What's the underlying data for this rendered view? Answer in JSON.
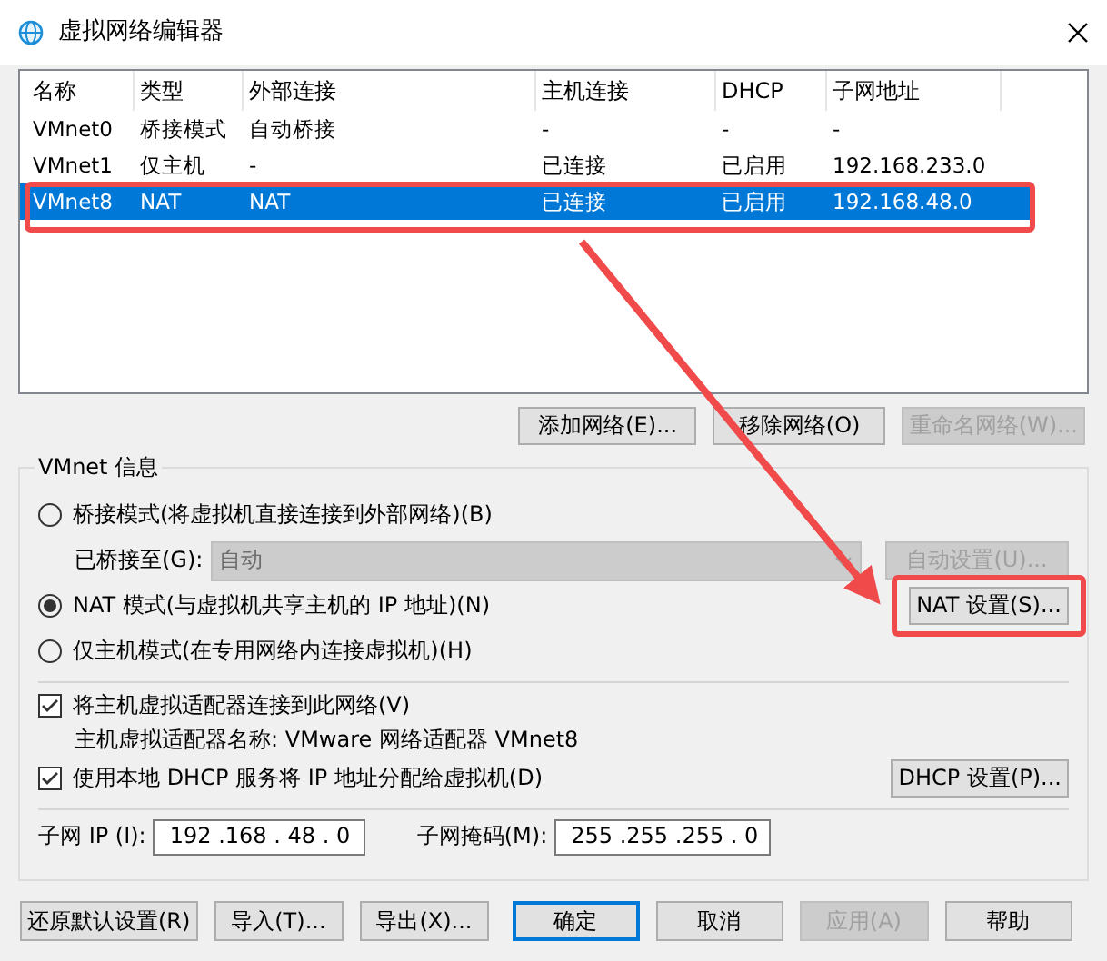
{
  "window": {
    "title": "虚拟网络编辑器"
  },
  "network_table": {
    "columns": [
      "名称",
      "类型",
      "外部连接",
      "主机连接",
      "DHCP",
      "子网地址"
    ],
    "rows": [
      {
        "cells": [
          "VMnet0",
          "桥接模式",
          "自动桥接",
          "-",
          "-",
          "-"
        ],
        "selected": false
      },
      {
        "cells": [
          "VMnet1",
          "仅主机",
          "-",
          "已连接",
          "已启用",
          "192.168.233.0"
        ],
        "selected": false
      },
      {
        "cells": [
          "VMnet8",
          "NAT",
          "NAT",
          "已连接",
          "已启用",
          "192.168.48.0"
        ],
        "selected": true
      }
    ]
  },
  "table_buttons": [
    {
      "label": "添加网络(E)...",
      "disabled": false
    },
    {
      "label": "移除网络(O)",
      "disabled": false
    },
    {
      "label": "重命名网络(W)...",
      "disabled": true
    }
  ],
  "vmnet_info": {
    "title": "VMnet 信息",
    "bridged_mode": {
      "label": "桥接模式(将虚拟机直接连接到外部网络)(B)",
      "selected": false
    },
    "bridged_to": {
      "label": "已桥接至(G):",
      "value": "自动",
      "disabled": true
    },
    "auto_settings_button": {
      "label": "自动设置(U)...",
      "disabled": true
    },
    "nat_mode": {
      "label": "NAT 模式(与虚拟机共享主机的 IP 地址)(N)",
      "selected": true
    },
    "nat_settings_button": {
      "label": "NAT 设置(S)...",
      "disabled": false
    },
    "host_only_mode": {
      "label": "仅主机模式(在专用网络内连接虚拟机)(H)",
      "selected": false
    },
    "connect_adapter": {
      "label": "将主机虚拟适配器连接到此网络(V)",
      "checked": true
    },
    "adapter_name": "主机虚拟适配器名称: VMware 网络适配器 VMnet8",
    "use_dhcp": {
      "label": "使用本地 DHCP 服务将 IP 地址分配给虚拟机(D)",
      "checked": true
    },
    "dhcp_settings_button": {
      "label": "DHCP 设置(P)...",
      "disabled": false
    },
    "subnet_ip": {
      "label": "子网 IP (I):",
      "value": "192 .168 . 48 . 0"
    },
    "subnet_mask": {
      "label": "子网掩码(M):",
      "value": "255 .255 .255 . 0"
    }
  },
  "footer_buttons": [
    {
      "label": "还原默认设置(R)",
      "disabled": false,
      "default": false
    },
    {
      "label": "导入(T)...",
      "disabled": false,
      "default": false
    },
    {
      "label": "导出(X)...",
      "disabled": false,
      "default": false
    },
    {
      "label": "确定",
      "disabled": false,
      "default": true
    },
    {
      "label": "取消",
      "disabled": false,
      "default": false
    },
    {
      "label": "应用(A)",
      "disabled": true,
      "default": false
    },
    {
      "label": "帮助",
      "disabled": false,
      "default": false
    }
  ]
}
